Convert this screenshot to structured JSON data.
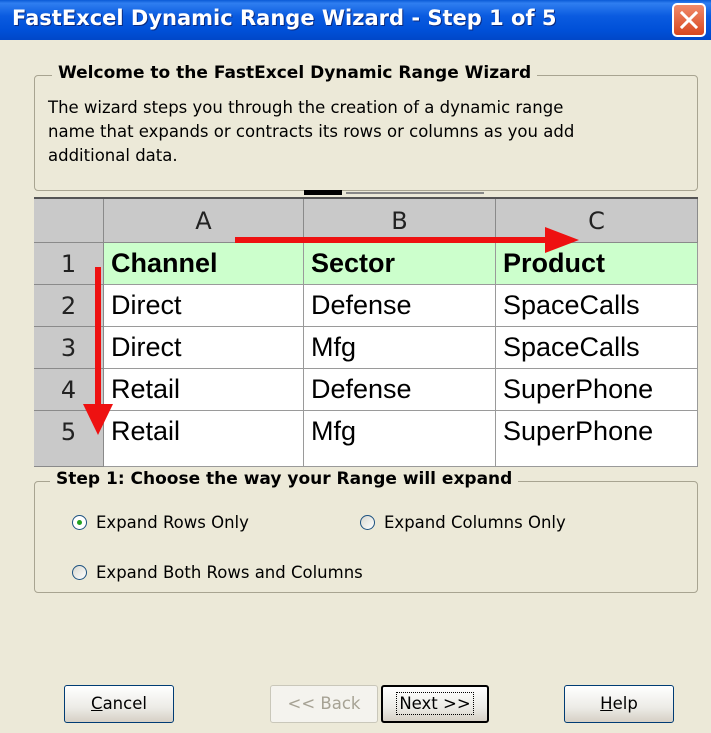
{
  "window": {
    "title": "FastExcel Dynamic Range Wizard - Step 1 of 5"
  },
  "welcome": {
    "heading": "Welcome to the FastExcel Dynamic Range Wizard",
    "lines": [
      "The wizard steps you through the creation of a dynamic range",
      "name that expands or contracts its rows or columns as you add",
      "additional data."
    ]
  },
  "spreadsheet": {
    "columns": [
      "A",
      "B",
      "C"
    ],
    "rows": [
      {
        "num": "1",
        "cells": [
          "Channel",
          "Sector",
          "Product"
        ]
      },
      {
        "num": "2",
        "cells": [
          "Direct",
          "Defense",
          "SpaceCalls"
        ]
      },
      {
        "num": "3",
        "cells": [
          "Direct",
          "Mfg",
          "SpaceCalls"
        ]
      },
      {
        "num": "4",
        "cells": [
          "Retail",
          "Defense",
          "SuperPhone"
        ]
      },
      {
        "num": "5",
        "cells": [
          "Retail",
          "Mfg",
          "SuperPhone"
        ]
      }
    ],
    "header_row_color": "#ccffcc",
    "arrow_color": "#ee1111"
  },
  "step": {
    "heading": "Step 1: Choose the way your Range will expand",
    "options": [
      {
        "label": "Expand Rows Only",
        "selected": true
      },
      {
        "label": "Expand Columns Only",
        "selected": false
      },
      {
        "label": "Expand Both Rows and Columns",
        "selected": false
      }
    ]
  },
  "buttons": {
    "cancel_first": "C",
    "cancel_rest": "ancel",
    "back": "<< Back",
    "next": "Next >>",
    "help_first": "H",
    "help_rest": "elp"
  },
  "colors": {
    "titlebar": "#0050d8",
    "dialog_bg": "#ece9d8"
  }
}
